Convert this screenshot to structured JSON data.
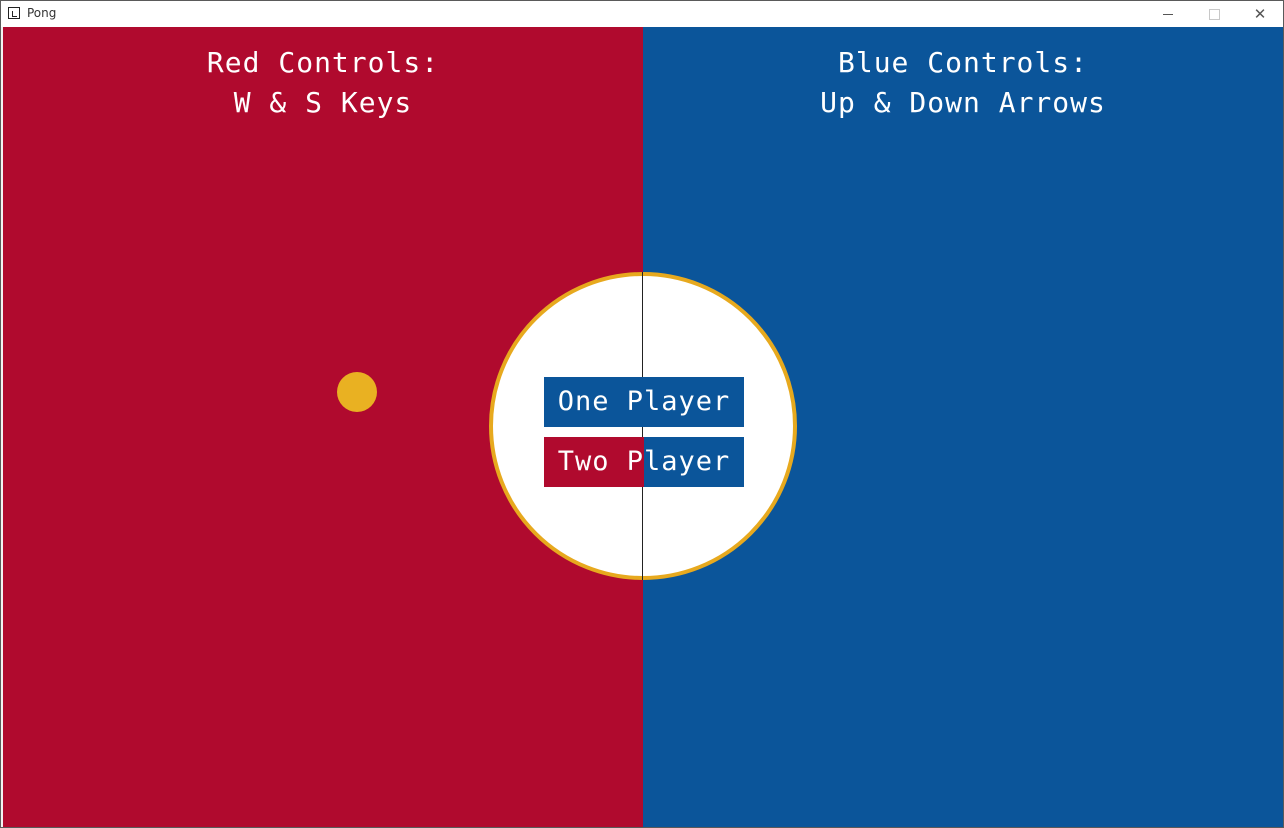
{
  "window": {
    "title": "Pong"
  },
  "game": {
    "red_controls": {
      "line1": "Red Controls:",
      "line2": "W & S Keys"
    },
    "blue_controls": {
      "line1": "Blue Controls:",
      "line2": "Up & Down Arrows"
    },
    "menu": {
      "one_player": "One Player",
      "two_player": "Two Player"
    }
  },
  "colors": {
    "red_side": "#b00a2e",
    "blue_side": "#0b559a",
    "ball": "#e9b122",
    "circle_border": "#e7a91e",
    "circle_fill": "#ffffff"
  }
}
